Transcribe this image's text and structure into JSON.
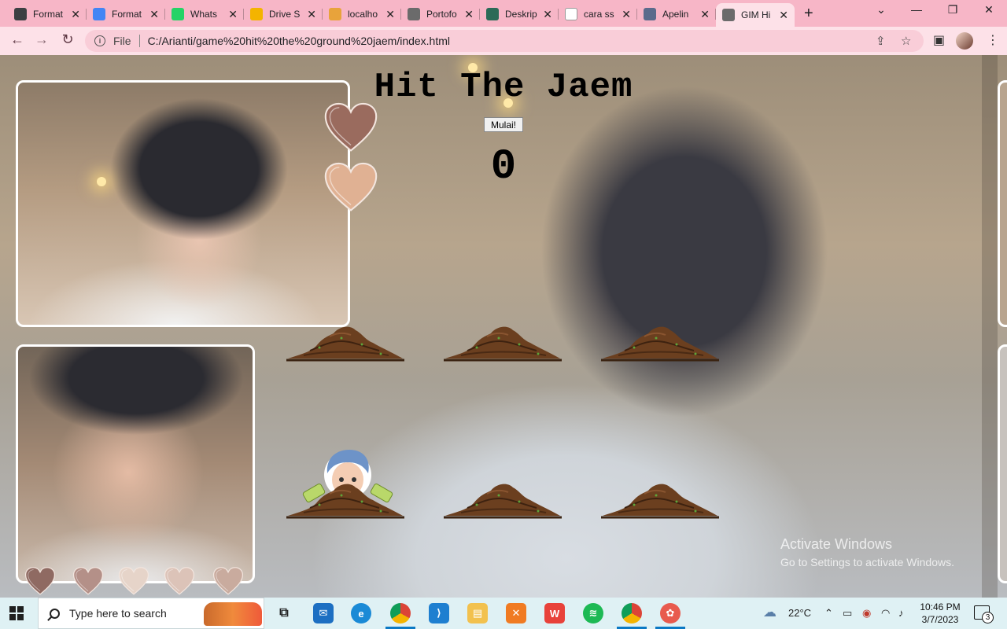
{
  "browser": {
    "tabs": [
      {
        "label": "Format",
        "icon": "classroom-icon",
        "color": "#3c4043"
      },
      {
        "label": "Format",
        "icon": "docs-icon",
        "color": "#4285f4"
      },
      {
        "label": "Whats",
        "icon": "whatsapp-icon",
        "color": "#25d366"
      },
      {
        "label": "Drive S",
        "icon": "drive-icon",
        "color": "#f4b400"
      },
      {
        "label": "localho",
        "icon": "phpmyadmin-icon",
        "color": "#e8a33b"
      },
      {
        "label": "Portofo",
        "icon": "globe-icon",
        "color": "#6b6b6b"
      },
      {
        "label": "Deskrip",
        "icon": "site-icon",
        "color": "#2b6a57"
      },
      {
        "label": "cara ss",
        "icon": "google-icon",
        "color": "#ffffff"
      },
      {
        "label": "Apelin",
        "icon": "app-icon",
        "color": "#5b6b8c"
      },
      {
        "label": "GIM Hi",
        "icon": "globe-icon",
        "color": "#6b6b6b",
        "active": true
      }
    ],
    "scheme": "File",
    "url": "C:/Arianti/game%20hit%20the%20ground%20jaem/index.html"
  },
  "game": {
    "title": "Hit The Jaem",
    "start_label": "Mulai!",
    "score": "0",
    "lives_top": [
      "#9a6b5e",
      "#e0b193"
    ],
    "lives_bottom": [
      "#8f6a62",
      "#b49088",
      "#e6d4c9",
      "#dcc3b8",
      "#c9ab9e"
    ],
    "mole_visible_hole": 3
  },
  "watermark": {
    "line1": "Activate Windows",
    "line2": "Go to Settings to activate Windows."
  },
  "taskbar": {
    "search_placeholder": "Type here to search",
    "weather": "22°C",
    "time": "10:46 PM",
    "date": "3/7/2023",
    "notifications": "3"
  }
}
